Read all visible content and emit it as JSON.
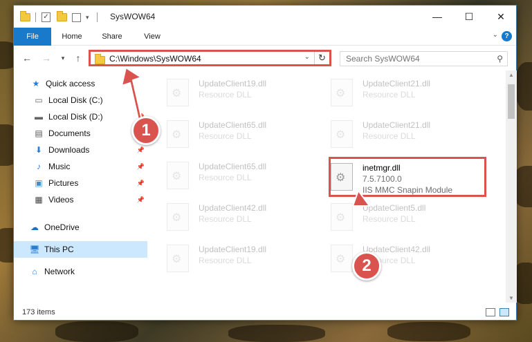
{
  "window": {
    "title": "SysWOW64"
  },
  "ribbon": {
    "tabs": [
      "File",
      "Home",
      "Share",
      "View"
    ],
    "help": "?"
  },
  "address": {
    "path": "C:\\Windows\\SysWOW64",
    "refresh": "↻"
  },
  "search": {
    "placeholder": "Search SysWOW64"
  },
  "sidebar": {
    "items": [
      {
        "label": "Quick access",
        "icon": "star-icon"
      },
      {
        "label": "Local Disk (C:)",
        "icon": "drive-icon"
      },
      {
        "label": "Local Disk (D:)",
        "icon": "drive-icon"
      },
      {
        "label": "Documents",
        "icon": "documents-icon"
      },
      {
        "label": "Downloads",
        "icon": "download-icon"
      },
      {
        "label": "Music",
        "icon": "music-icon"
      },
      {
        "label": "Pictures",
        "icon": "pictures-icon"
      },
      {
        "label": "Videos",
        "icon": "videos-icon"
      },
      {
        "label": "OneDrive",
        "icon": "cloud-icon"
      },
      {
        "label": "This PC",
        "icon": "computer-icon"
      },
      {
        "label": "Network",
        "icon": "network-icon"
      }
    ]
  },
  "files": [
    {
      "name": "UpdateClient19.dll",
      "type": "Resource DLL"
    },
    {
      "name": "UpdateClient21.dll",
      "type": "Resource DLL"
    },
    {
      "name": "UpdateClient65.dll",
      "type": "Resource DLL"
    },
    {
      "name": "UpdateClient21.dll",
      "type": "Resource DLL"
    },
    {
      "name": "UpdateClient65.dll",
      "type": "Resource DLL"
    },
    {
      "name": "UpdateClient42.dll",
      "type": "Resource DLL"
    },
    {
      "name": "UpdateClient5.dll",
      "type": "Resource DLL"
    },
    {
      "name": "UpdateClient19.dll",
      "type": "Resource DLL"
    },
    {
      "name": "UpdateClient42.dll",
      "type": "Resource DLL"
    }
  ],
  "target_file": {
    "name": "inetmgr.dll",
    "version": "7.5.7100.0",
    "description": "IIS MMC Snapin Module"
  },
  "status": {
    "count": "173 items"
  },
  "annotations": {
    "step1": "1",
    "step2": "2",
    "color": "#d9534f"
  }
}
